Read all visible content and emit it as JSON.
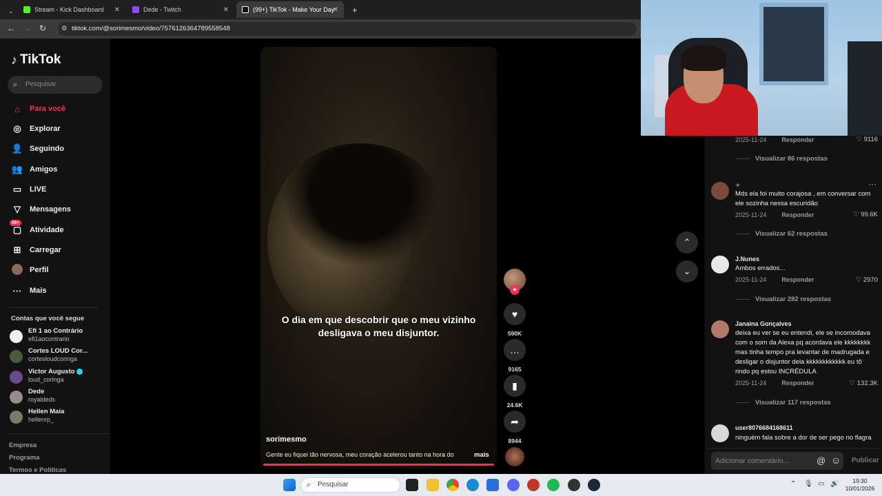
{
  "browser": {
    "tabs": [
      {
        "title": "Stream - Kick Dashboard",
        "color": "#53fc18"
      },
      {
        "title": "Dede - Twitch",
        "color": "#9146ff"
      },
      {
        "title": "(99+) TikTok - Make Your Day",
        "color": "#ffffff"
      }
    ],
    "new_tab": "+",
    "url": "tiktok.com/@sorimesmo/video/7576126364789558548"
  },
  "sidebar": {
    "logo": "TikTok",
    "search_placeholder": "Pesquisar",
    "nav": [
      {
        "label": "Para você",
        "icon": "home-icon"
      },
      {
        "label": "Explorar",
        "icon": "compass-icon"
      },
      {
        "label": "Seguindo",
        "icon": "following-icon"
      },
      {
        "label": "Amigos",
        "icon": "friends-icon"
      },
      {
        "label": "LIVE",
        "icon": "live-icon"
      },
      {
        "label": "Mensagens",
        "icon": "messages-icon"
      },
      {
        "label": "Atividade",
        "icon": "activity-icon",
        "badge": "99+"
      },
      {
        "label": "Carregar",
        "icon": "upload-icon"
      },
      {
        "label": "Perfil",
        "icon": "profile-icon"
      },
      {
        "label": "Mais",
        "icon": "more-icon"
      }
    ],
    "following_title": "Contas que você segue",
    "following": [
      {
        "name": "Efi 1 ao Contrário",
        "handle": "efi1aocontrario"
      },
      {
        "name": "Cortes LOUD Cor...",
        "handle": "cortesloudcoringa"
      },
      {
        "name": "Victor Augusto",
        "handle": "loud_coringa",
        "verified": true
      },
      {
        "name": "Dede",
        "handle": "royaldeds"
      },
      {
        "name": "Hellen Maia",
        "handle": "hellenrp_"
      }
    ],
    "footer": [
      "Empresa",
      "Programa",
      "Termos e Políticas"
    ]
  },
  "video": {
    "caption": "O dia em que descobrir que o meu vizinho desligava o meu disjuntor.",
    "author": "sorimesmo",
    "description": "Gente eu fiquei tão nervosa, meu coração acelerou tanto na hora do",
    "more": "mais",
    "progress": 1.0,
    "actions": {
      "likes": "590K",
      "comments": "9165",
      "saves": "24.6K",
      "shares": "8944"
    }
  },
  "comments": [
    {
      "name": "",
      "text": "",
      "date": "2025-11-24",
      "reply": "Responder",
      "likes": "9116",
      "replies": "Visualizar 86 respostas"
    },
    {
      "name": "",
      "text": "Mds ela foi muito corajosa , em conversar com ele sozinha nessa escuridão",
      "date": "2025-11-24",
      "reply": "Responder",
      "likes": "99.6K",
      "replies": "Visualizar 62 respostas"
    },
    {
      "name": "J.Nunes",
      "text": "Ambos errados...",
      "date": "2025-11-24",
      "reply": "Responder",
      "likes": "2970",
      "replies": "Visualizar 282 respostas"
    },
    {
      "name": "Janaina Gonçalves",
      "text": "deixa eu ver se eu entendi, ele se incomodava com o som da Alexa pq acordava ele kkkkkkkk mas tinha tempo pra levantar de madrugada e desligar o disjuntor dela kkkkkkkkkkkk eu tô rindo pq estou INCRÉDULA",
      "date": "2025-11-24",
      "reply": "Responder",
      "likes": "132.3K",
      "replies": "Visualizar 117 respostas"
    },
    {
      "name": "user8076684168611",
      "text": "ninguém fala sobre a dor de ser pego no flagra",
      "date": "",
      "reply": "",
      "likes": "",
      "replies": ""
    }
  ],
  "composer": {
    "placeholder": "Adicionar comentário...",
    "publish": "Publicar"
  },
  "taskbar": {
    "search": "Pesquisar",
    "time": "19:30",
    "date": "10/01/2026"
  }
}
